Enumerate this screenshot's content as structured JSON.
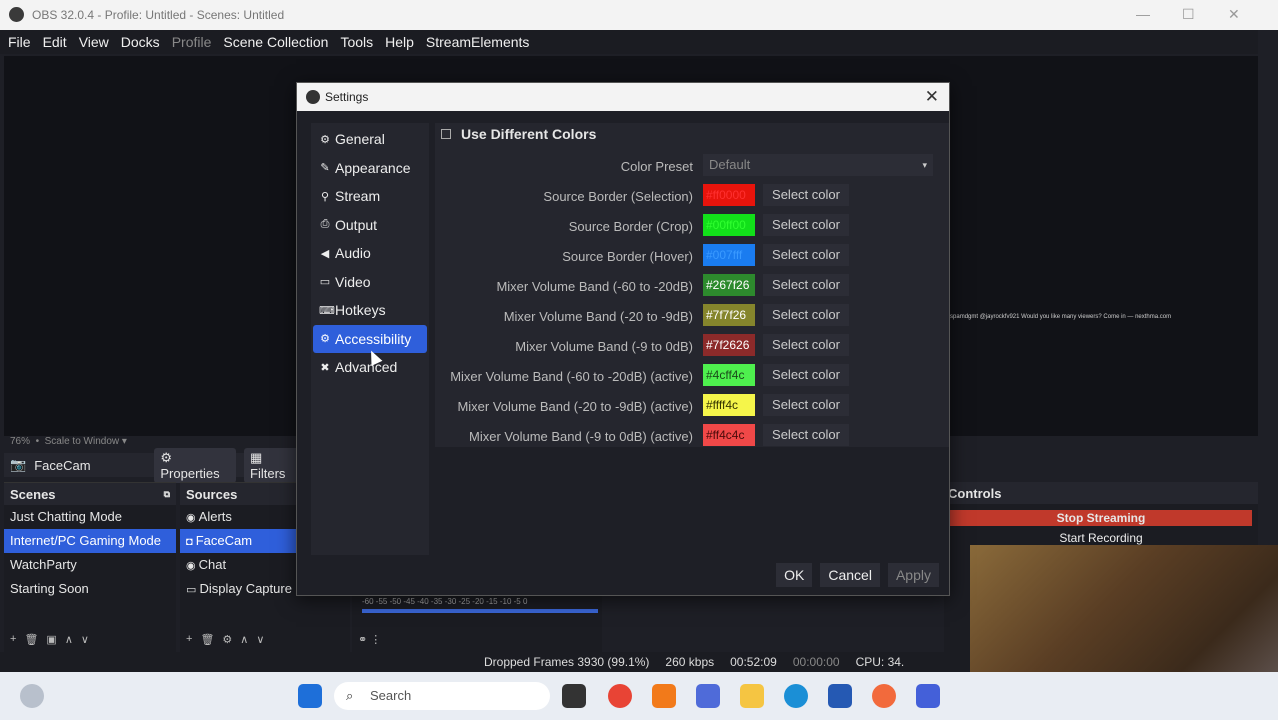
{
  "window": {
    "title": "OBS 32.0.4 - Profile: Untitled - Scenes: Untitled"
  },
  "menu": [
    "File",
    "Edit",
    "View",
    "Docks",
    "Profile",
    "Scene Collection",
    "Tools",
    "Help",
    "StreamElements"
  ],
  "menu_disabled_index": 4,
  "zoom": {
    "percent": "76%",
    "mode": "Scale to Window"
  },
  "source_bar": {
    "name": "FaceCam",
    "properties": "Properties",
    "filters": "Filters"
  },
  "scenes": {
    "title": "Scenes",
    "items": [
      "Just Chatting Mode",
      "Internet/PC Gaming Mode",
      "WatchParty",
      "Starting Soon"
    ],
    "selected": 1
  },
  "sources": {
    "title": "Sources",
    "items": [
      "Alerts",
      "FaceCam",
      "Chat",
      "Display Capture"
    ],
    "selected": 1
  },
  "controls": {
    "title": "Controls",
    "stop": "Stop Streaming",
    "record": "Start Recording"
  },
  "status": {
    "dropped": "Dropped Frames 3930 (99.1%)",
    "bitrate": "260 kbps",
    "live_time": "00:52:09",
    "rec_time": "00:00:00",
    "cpu": "CPU: 34."
  },
  "chat_overlay": "businessthespamdgmt @jayrockfv921 Would you like many viewers? Come in — nexthma.com",
  "taskbar": {
    "search": "Search"
  },
  "settings": {
    "title": "Settings",
    "nav": [
      {
        "label": "General",
        "icon": "gear-icon"
      },
      {
        "label": "Appearance",
        "icon": "palette-icon"
      },
      {
        "label": "Stream",
        "icon": "antenna-icon"
      },
      {
        "label": "Output",
        "icon": "output-icon"
      },
      {
        "label": "Audio",
        "icon": "speaker-icon"
      },
      {
        "label": "Video",
        "icon": "monitor-icon"
      },
      {
        "label": "Hotkeys",
        "icon": "keyboard-icon"
      },
      {
        "label": "Accessibility",
        "icon": "accessibility-icon"
      },
      {
        "label": "Advanced",
        "icon": "wrench-icon"
      }
    ],
    "nav_selected": 7,
    "use_different_colors": "Use Different Colors",
    "color_preset": {
      "label": "Color Preset",
      "value": "Default"
    },
    "select_color": "Select color",
    "colors": [
      {
        "label": "Source Border (Selection)",
        "hex": "#ff0000",
        "color": "#e8140c",
        "text_color": "#ff3030"
      },
      {
        "label": "Source Border (Crop)",
        "hex": "#00ff00",
        "color": "#12e01a",
        "text_color": "#30ff30"
      },
      {
        "label": "Source Border (Hover)",
        "hex": "#007fff",
        "color": "#1a7cf0",
        "text_color": "#3a9aff"
      },
      {
        "label": "Mixer Volume Band (-60 to -20dB)",
        "hex": "#267f26",
        "color": "#2d8a2d",
        "text_color": "#ffffff"
      },
      {
        "label": "Mixer Volume Band (-20 to -9dB)",
        "hex": "#7f7f26",
        "color": "#85852c",
        "text_color": "#ffffff"
      },
      {
        "label": "Mixer Volume Band (-9 to 0dB)",
        "hex": "#7f2626",
        "color": "#8c2a2a",
        "text_color": "#ffffff"
      },
      {
        "label": "Mixer Volume Band (-60 to -20dB) (active)",
        "hex": "#4cff4c",
        "color": "#4ef04e",
        "text_color": "#1a4a1a"
      },
      {
        "label": "Mixer Volume Band (-20 to -9dB) (active)",
        "hex": "#ffff4c",
        "color": "#f5f54a",
        "text_color": "#333300"
      },
      {
        "label": "Mixer Volume Band (-9 to 0dB) (active)",
        "hex": "#ff4c4c",
        "color": "#f04848",
        "text_color": "#4a0a0a"
      }
    ],
    "buttons": {
      "ok": "OK",
      "cancel": "Cancel",
      "apply": "Apply"
    }
  }
}
